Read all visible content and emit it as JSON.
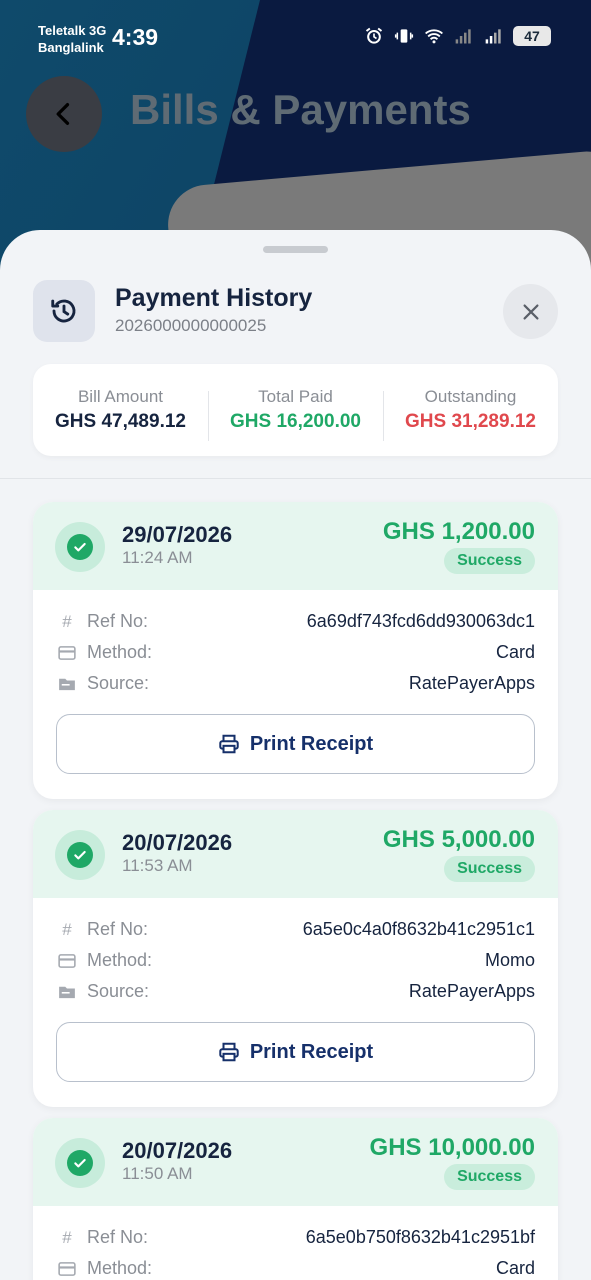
{
  "status_bar": {
    "carrier_1": "Teletalk 3G",
    "carrier_2": "Banglalink",
    "time": "4:39",
    "battery": "47"
  },
  "header": {
    "title": "Bills & Payments"
  },
  "sheet": {
    "title": "Payment History",
    "subtitle": "2026000000000025"
  },
  "summary": {
    "bill_amount_label": "Bill Amount",
    "bill_amount_value": "GHS 47,489.12",
    "total_paid_label": "Total Paid",
    "total_paid_value": "GHS 16,200.00",
    "outstanding_label": "Outstanding",
    "outstanding_value": "GHS 31,289.12"
  },
  "labels": {
    "ref_no": "Ref No:",
    "method": "Method:",
    "source": "Source:",
    "print_receipt": "Print Receipt"
  },
  "payments": [
    {
      "date": "29/07/2026",
      "time": "11:24 AM",
      "amount": "GHS 1,200.00",
      "status": "Success",
      "ref_no": "6a69df743fcd6dd930063dc1",
      "method": "Card",
      "source": "RatePayerApps"
    },
    {
      "date": "20/07/2026",
      "time": "11:53 AM",
      "amount": "GHS 5,000.00",
      "status": "Success",
      "ref_no": "6a5e0c4a0f8632b41c2951c1",
      "method": "Momo",
      "source": "RatePayerApps"
    },
    {
      "date": "20/07/2026",
      "time": "11:50 AM",
      "amount": "GHS 10,000.00",
      "status": "Success",
      "ref_no": "6a5e0b750f8632b41c2951bf",
      "method": "Card"
    }
  ],
  "colors": {
    "paid_green": "#1fa866",
    "outstanding_red": "#e0484d",
    "navy": "#16243f"
  }
}
